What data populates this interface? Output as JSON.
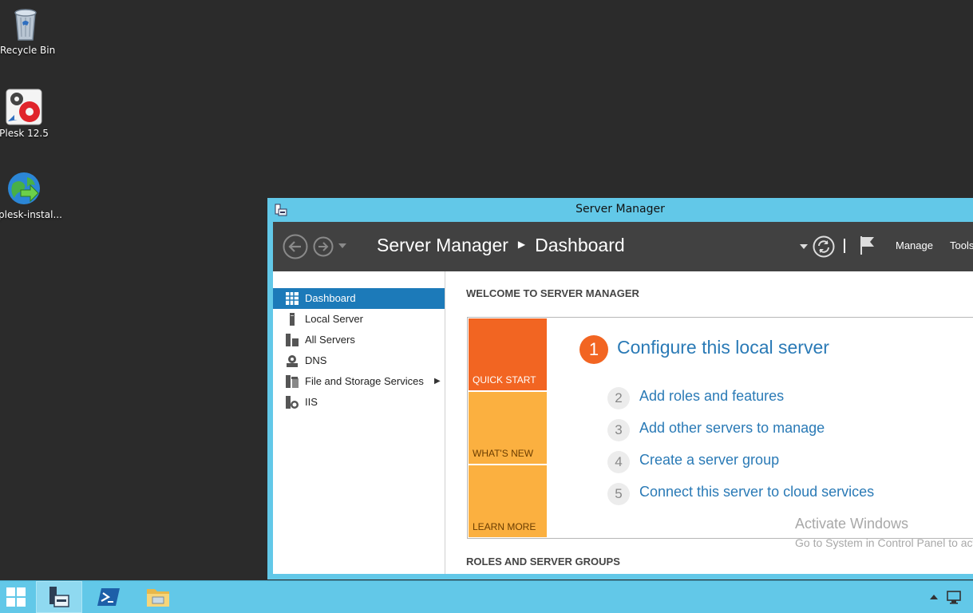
{
  "desktop": {
    "icons": [
      {
        "label": "Recycle Bin",
        "icon": "recycle-bin-icon"
      },
      {
        "label": "Plesk 12.5",
        "icon": "plesk-icon"
      },
      {
        "label": "plesk-instal...",
        "icon": "installer-globe-icon"
      }
    ]
  },
  "window": {
    "title": "Server Manager",
    "breadcrumb": {
      "root": "Server Manager",
      "current": "Dashboard"
    },
    "menu": {
      "manage": "Manage",
      "tools": "Tools"
    }
  },
  "sidebar": {
    "items": [
      {
        "label": "Dashboard",
        "icon": "dashboard-grid-icon",
        "active": true
      },
      {
        "label": "Local Server",
        "icon": "local-server-icon"
      },
      {
        "label": "All Servers",
        "icon": "all-servers-icon"
      },
      {
        "label": "DNS",
        "icon": "dns-icon"
      },
      {
        "label": "File and Storage Services",
        "icon": "storage-icon",
        "has_submenu": true
      },
      {
        "label": "IIS",
        "icon": "iis-icon"
      }
    ]
  },
  "main": {
    "welcome_heading": "WELCOME TO SERVER MANAGER",
    "tiles": {
      "quick_start": "QUICK START",
      "whats_new": "WHAT'S NEW",
      "learn_more": "LEARN MORE"
    },
    "steps": [
      {
        "num": "1",
        "label": "Configure this local server"
      },
      {
        "num": "2",
        "label": "Add roles and features"
      },
      {
        "num": "3",
        "label": "Add other servers to manage"
      },
      {
        "num": "4",
        "label": "Create a server group"
      },
      {
        "num": "5",
        "label": "Connect this server to cloud services"
      }
    ],
    "activation": {
      "title": "Activate Windows",
      "subtitle": "Go to System in Control Panel to activ"
    },
    "roles_heading": "ROLES AND SERVER GROUPS"
  },
  "colors": {
    "accent": "#1c7ab9",
    "quick_start": "#f26522",
    "secondary_tile": "#fbb040",
    "link": "#2a7ab6",
    "chrome": "#62c8e8"
  }
}
